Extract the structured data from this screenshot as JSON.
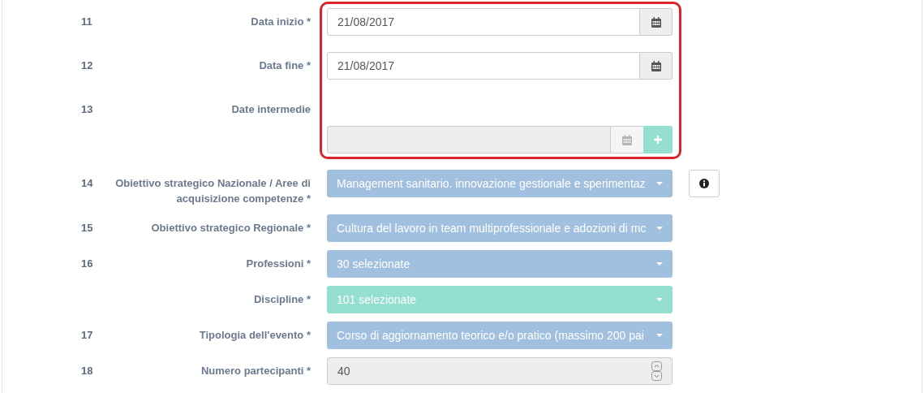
{
  "sections": [
    {
      "highlighted": true,
      "fields": [
        {
          "number": "11",
          "label": "Data inizio *",
          "kind": "date",
          "value": "21/08/2017",
          "disabled": false
        },
        {
          "number": "12",
          "label": "Data fine *",
          "kind": "date",
          "value": "21/08/2017",
          "disabled": false
        },
        {
          "number": "13",
          "label": "Date intermedie",
          "kind": "date-add",
          "disabled": true
        }
      ]
    },
    {
      "highlighted": false,
      "fields": [
        {
          "number": "14",
          "label": "Obiettivo strategico Nazionale / Aree di acquisizione competenze *",
          "kind": "select",
          "value": "Management sanitario. innovazione gestionale e sperimentaz",
          "color": "#a1bfdf",
          "info": true
        },
        {
          "number": "15",
          "label": "Obiettivo strategico Regionale *",
          "kind": "select",
          "value": "Cultura del lavoro in team multiprofessionale e adozioni di mc",
          "color": "#a1bfdf",
          "info": false
        },
        {
          "number": "16",
          "label": "Professioni *",
          "kind": "select",
          "value": "30 selezionate",
          "color": "#a1bfdf",
          "info": false
        },
        {
          "label": "Discipline *",
          "kind": "select",
          "value": "101 selezionate",
          "color": "#94dfcf",
          "info": false
        },
        {
          "number": "17",
          "label": "Tipologia dell'evento *",
          "kind": "select",
          "value": "Corso di aggiornamento teorico e/o pratico (massimo 200 pai",
          "color": "#a1bfdf",
          "info": false
        },
        {
          "number": "18",
          "label": "Numero partecipanti *",
          "kind": "number",
          "value": "40",
          "disabled": true
        }
      ]
    }
  ]
}
